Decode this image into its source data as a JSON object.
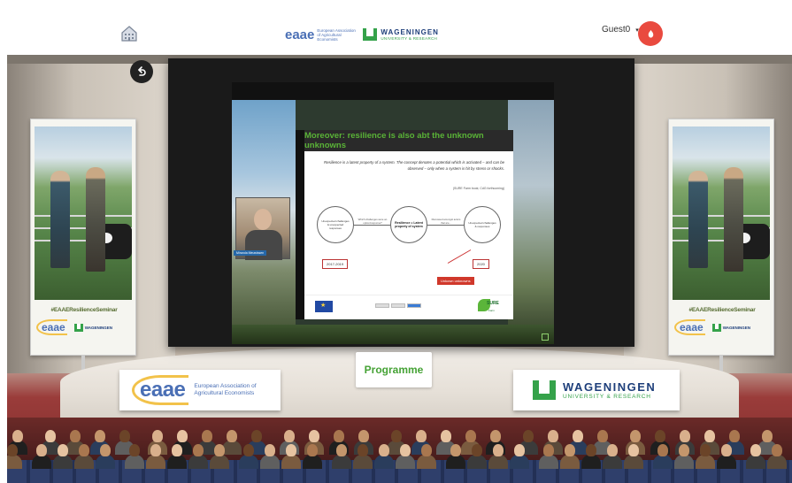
{
  "topbar": {
    "home_icon": "home-icon",
    "eaae_logo_text": "eaae",
    "eaae_logo_sub": "European Association of Agricultural Economists",
    "wur_logo_name": "WAGENINGEN",
    "wur_logo_sub": "UNIVERSITY & RESEARCH",
    "user_name": "Guest0",
    "user_caret": "▾",
    "notification_icon": "alarm-icon",
    "notification_color": "#e94a3f"
  },
  "stage": {
    "back_icon": "back-arrow-icon",
    "slide": {
      "title": "Moreover: resilience is also abt the unknown unknowns",
      "quote": "Resilience is a latent property of a system. The concept denotes a potential which is activated – and can be observed – only when a system is hit by stress or shocks.",
      "citation": "(SURE Farm book; CdG forthcoming)",
      "circle_left": "Unexpected challenges & unexpected responses",
      "circle_mid": "Resilience = Latent property of system",
      "circle_right": "Unexpected challenges & responses",
      "arrow_label_1": "Which challenges were an option/response?",
      "arrow_label_2": "Discussed amongst actors that are...",
      "year_start": "2017-2019",
      "year_end": "2020",
      "unknowns_tag": "Unkown unknowns",
      "surefarm_name": "SURE",
      "surefarm_sub": "Farm"
    },
    "presenter_tag": "Miranda Meuwissen",
    "banner_hashtag": "#EAAEResilienceSeminar",
    "banner_eaae": "eaae",
    "banner_wur": "WAGENINGEN",
    "programme_label": "Programme",
    "podium_left": {
      "logo": "eaae",
      "text": "European Association of Agricultural Economists"
    },
    "podium_right": {
      "name": "WAGENINGEN",
      "sub": "UNIVERSITY & RESEARCH"
    }
  },
  "colors": {
    "accent_green": "#45a235",
    "eaae_blue": "#4a6fb5",
    "wur_navy": "#1d3e7a"
  }
}
